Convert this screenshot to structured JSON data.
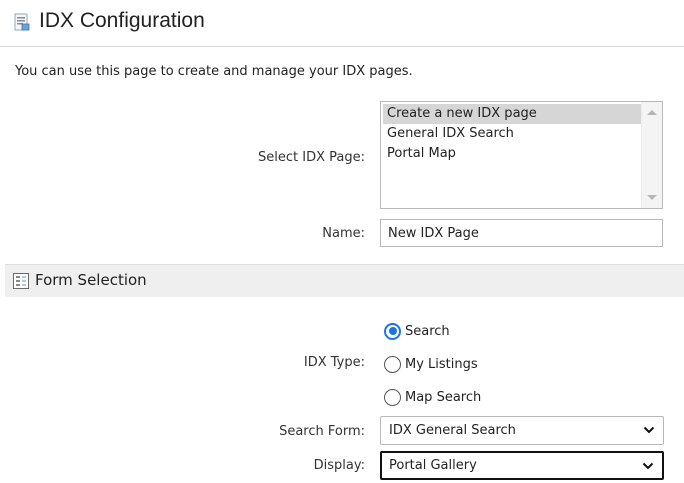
{
  "header": {
    "title": "IDX Configuration",
    "icon": "page-icon"
  },
  "intro": "You can use this page to create and manage your IDX pages.",
  "select_idx_page": {
    "label": "Select IDX Page:",
    "options": [
      "Create a new IDX page",
      "General IDX Search",
      "Portal Map"
    ],
    "selected": "Create a new IDX page"
  },
  "name_field": {
    "label": "Name:",
    "value": "New IDX Page"
  },
  "form_section": {
    "title": "Form Selection",
    "icon": "form-icon"
  },
  "idx_type": {
    "label": "IDX Type:",
    "options": [
      "Search",
      "My Listings",
      "Map Search"
    ],
    "selected": "Search"
  },
  "search_form": {
    "label": "Search Form:",
    "value": "IDX General Search"
  },
  "display": {
    "label": "Display:",
    "value": "Portal Gallery"
  },
  "colors": {
    "radio_accent": "#1a73e8",
    "selected_item_bg": "#d6d6d6",
    "section_bg": "#efefef"
  }
}
